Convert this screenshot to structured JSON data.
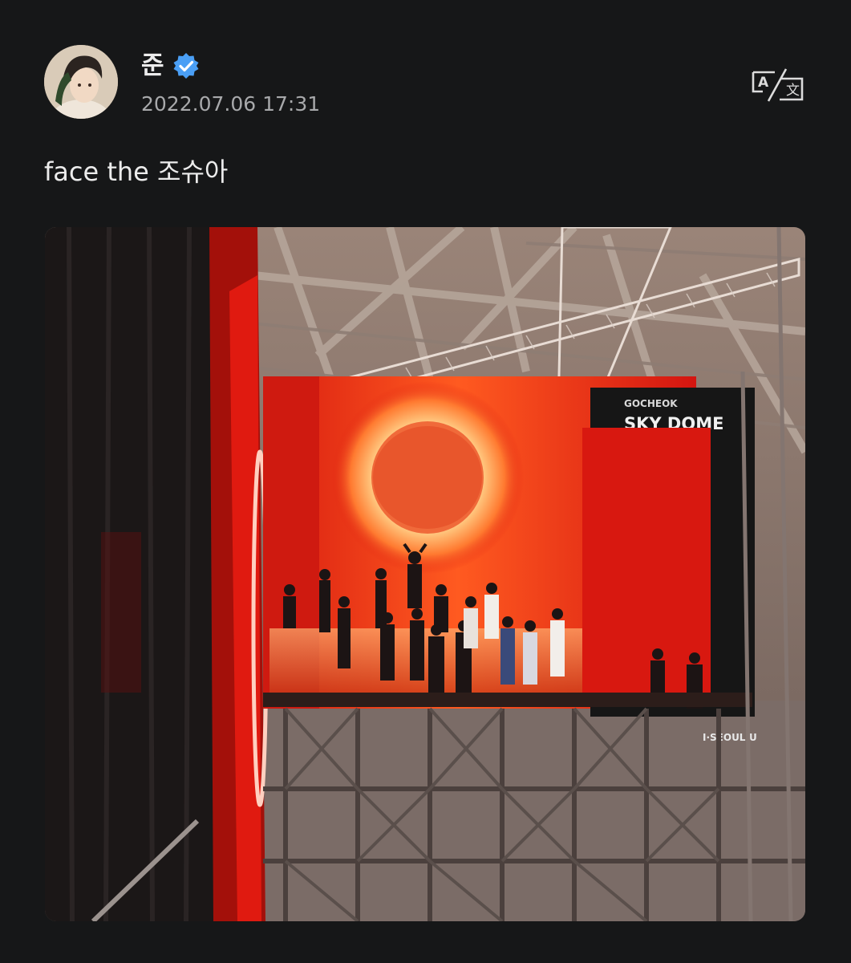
{
  "post": {
    "author_name": "준",
    "timestamp": "2022.07.06 17:31",
    "text": "face the 조슈아",
    "verified_color": "#4a9ff5"
  },
  "photo": {
    "venue_sign_line1": "GOCHEOK",
    "venue_sign_line2": "SKY DOME",
    "sponsor_sign": "I·SEOUL·U"
  },
  "icons": {
    "verified": "verified-badge-icon",
    "translate": "translate-icon"
  },
  "colors": {
    "background": "#161718",
    "text_primary": "#ececec",
    "text_secondary": "#a8a9ab"
  }
}
